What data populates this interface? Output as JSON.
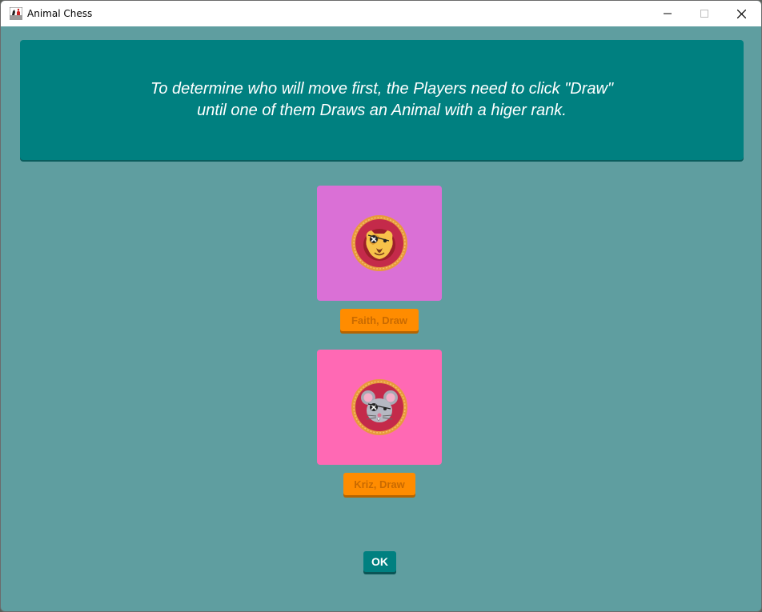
{
  "window": {
    "title": "Animal Chess",
    "app_icon": "chess-pieces-icon",
    "controls": [
      "minimize-icon",
      "maximize-icon",
      "close-icon"
    ]
  },
  "banner": {
    "line1": "To determine who will move first, the Players need to click \"Draw\"",
    "line2": "until one of them Draws an Animal with a higer rank."
  },
  "players": [
    {
      "card_color": "#da70d6",
      "animal_icon": "pirate-lion-icon",
      "draw_label": "Faith, Draw"
    },
    {
      "card_color": "#ff69b4",
      "animal_icon": "pirate-mouse-icon",
      "draw_label": "Kriz, Draw"
    }
  ],
  "ok_label": "OK",
  "colors": {
    "background": "#5f9ea0",
    "banner": "#008080",
    "draw_button": "#ff8c00",
    "ok_button": "#008080"
  }
}
